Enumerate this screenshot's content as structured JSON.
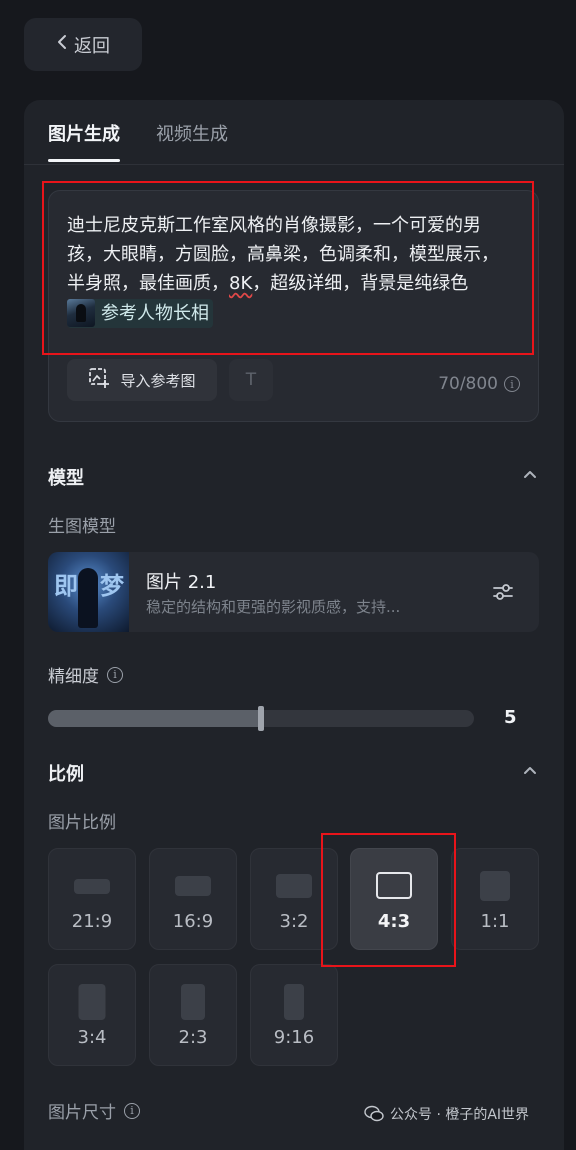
{
  "back": {
    "label": "返回"
  },
  "tabs": [
    {
      "label": "图片生成",
      "active": true
    },
    {
      "label": "视频生成",
      "active": false
    }
  ],
  "prompt": {
    "text": "迪士尼皮克斯工作室风格的肖像摄影，一个可爱的男孩，大眼睛，方圆脸，高鼻梁，色调柔和，模型展示，半身照，最佳画质，",
    "text_flagged": "8K",
    "text_tail": "，超级详细，背景是纯绿色",
    "ref_chip_label": "参考人物长相",
    "import_label": "导入参考图",
    "text_icon": "T",
    "char_count": "70/800"
  },
  "model_section": {
    "title": "模型",
    "sub_label": "生图模型",
    "model_name": "图片 2.1",
    "model_desc": "稳定的结构和更强的影视质感，支持...",
    "thumb_glyph_1": "即",
    "thumb_glyph_2": "梦"
  },
  "detail": {
    "label": "精细度",
    "value": "5",
    "fill_fraction": 0.5
  },
  "ratio_section": {
    "title": "比例",
    "sub_label": "图片比例",
    "options": [
      {
        "label": "21:9",
        "selected": false
      },
      {
        "label": "16:9",
        "selected": false
      },
      {
        "label": "3:2",
        "selected": false
      },
      {
        "label": "4:3",
        "selected": true
      },
      {
        "label": "1:1",
        "selected": false
      },
      {
        "label": "3:4",
        "selected": false
      },
      {
        "label": "2:3",
        "selected": false
      },
      {
        "label": "9:16",
        "selected": false
      }
    ]
  },
  "size_label": "图片尺寸",
  "watermark": {
    "text": "公众号 · 橙子的AI世界"
  },
  "colors": {
    "accent_red": "#e8141a",
    "panel": "#202329",
    "background": "#16181d"
  }
}
